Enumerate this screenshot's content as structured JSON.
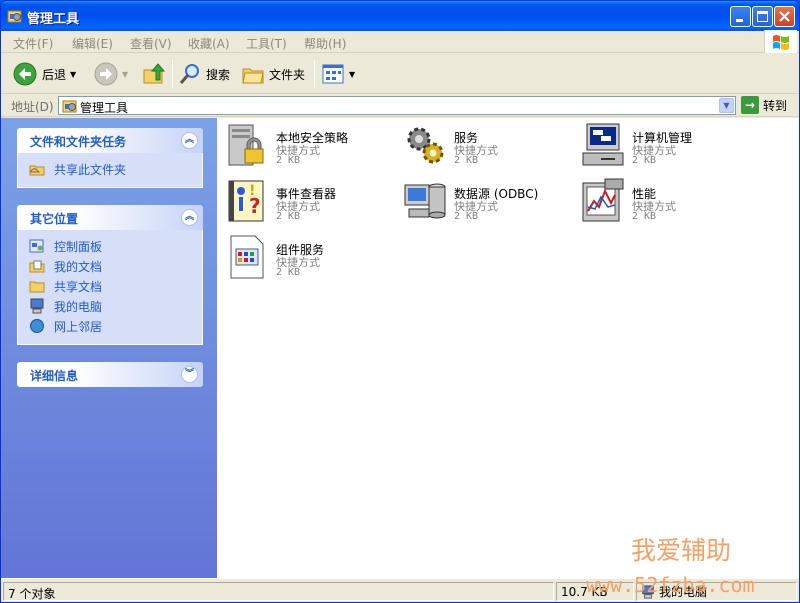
{
  "window": {
    "title": "管理工具"
  },
  "menu": [
    "文件(F)",
    "编辑(E)",
    "查看(V)",
    "收藏(A)",
    "工具(T)",
    "帮助(H)"
  ],
  "toolbar": {
    "back": "后退",
    "search": "搜索",
    "folders": "文件夹"
  },
  "address": {
    "label": "地址(D)",
    "value": "管理工具",
    "go": "转到"
  },
  "tasks": {
    "file_tasks": {
      "title": "文件和文件夹任务",
      "items": [
        "共享此文件夹"
      ]
    },
    "other_places": {
      "title": "其它位置",
      "items": [
        "控制面板",
        "我的文档",
        "共享文档",
        "我的电脑",
        "网上邻居"
      ]
    },
    "details": {
      "title": "详细信息"
    }
  },
  "files": [
    {
      "name": "本地安全策略",
      "type": "快捷方式",
      "size": "2 KB",
      "icon": "security-policy-icon"
    },
    {
      "name": "服务",
      "type": "快捷方式",
      "size": "2 KB",
      "icon": "services-gears-icon"
    },
    {
      "name": "计算机管理",
      "type": "快捷方式",
      "size": "2 KB",
      "icon": "computer-management-icon"
    },
    {
      "name": "事件查看器",
      "type": "快捷方式",
      "size": "2 KB",
      "icon": "event-viewer-icon"
    },
    {
      "name": "数据源 (ODBC)",
      "type": "快捷方式",
      "size": "2 KB",
      "icon": "odbc-datasource-icon"
    },
    {
      "name": "性能",
      "type": "快捷方式",
      "size": "2 KB",
      "icon": "performance-icon"
    },
    {
      "name": "组件服务",
      "type": "快捷方式",
      "size": "2 KB",
      "icon": "component-services-icon"
    }
  ],
  "status": {
    "count": "7 个对象",
    "size": "10.7 KB",
    "location": "我的电脑"
  },
  "watermark": {
    "line1": "我爱辅助",
    "line2": "www.52fzba.com"
  },
  "colors": {
    "title_bar": "#0054e3",
    "task_pane": "#6375d6",
    "link": "#215dc6"
  }
}
